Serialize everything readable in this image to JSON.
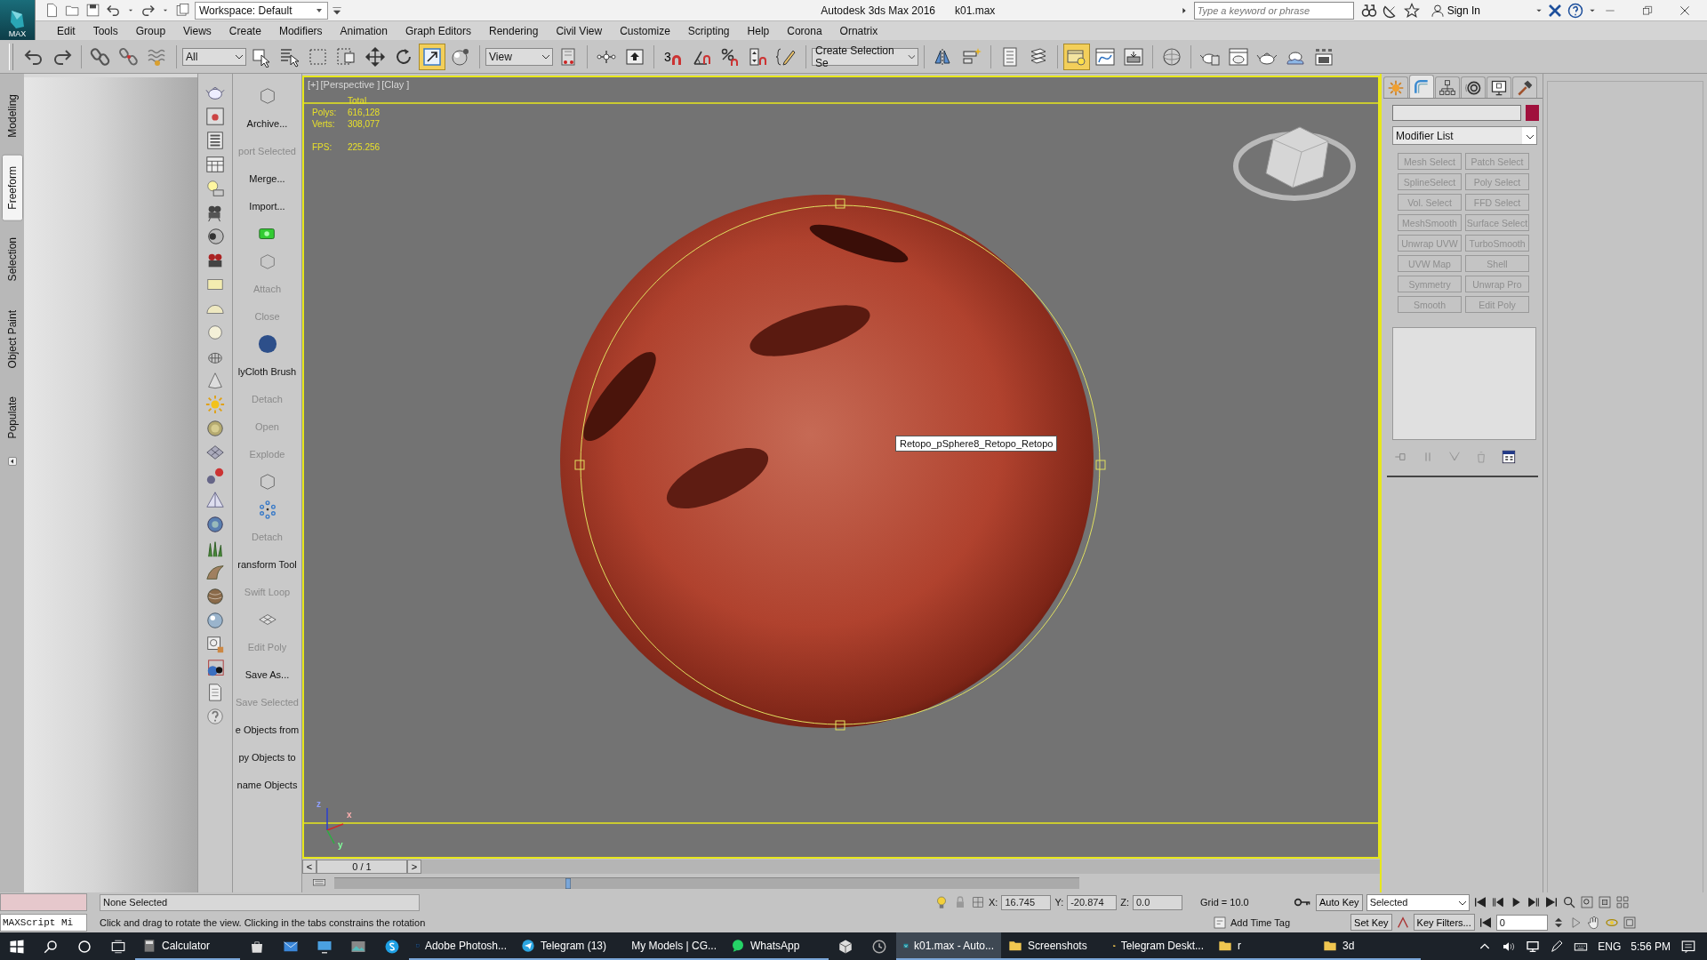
{
  "title_bar": {
    "logo": "MAX",
    "workspace": "Workspace: Default",
    "app_title": "Autodesk 3ds Max 2016",
    "file_name": "k01.max",
    "search": {
      "placeholder": "Type a keyword or phrase"
    },
    "sign_in": "Sign In"
  },
  "menu": [
    "Edit",
    "Tools",
    "Group",
    "Views",
    "Create",
    "Modifiers",
    "Animation",
    "Graph Editors",
    "Rendering",
    "Civil View",
    "Customize",
    "Scripting",
    "Help",
    "Corona",
    "Ornatrix"
  ],
  "toolbar": [
    {
      "kind": "button",
      "selected": false
    },
    {
      "kind": "button",
      "selected": false
    },
    {
      "kind": "button",
      "selected": false
    },
    {
      "kind": "button",
      "selected": false
    },
    {
      "kind": "button",
      "selected": false
    },
    {
      "kind": "dropdown",
      "value": "All"
    },
    {
      "kind": "button",
      "selected": false
    },
    {
      "kind": "button",
      "selected": false
    },
    {
      "kind": "button",
      "selected": false
    },
    {
      "kind": "button",
      "selected": false
    },
    {
      "kind": "button",
      "selected": false
    },
    {
      "kind": "button",
      "selected": false
    },
    {
      "kind": "button",
      "selected": true
    },
    {
      "kind": "button",
      "selected": false
    },
    {
      "kind": "dropdown",
      "value": "View"
    },
    {
      "kind": "button",
      "selected": false
    },
    {
      "kind": "button",
      "selected": false
    },
    {
      "kind": "button",
      "selected": false
    },
    {
      "kind": "snap",
      "label": "3",
      "selected": false
    },
    {
      "kind": "button",
      "selected": false
    },
    {
      "kind": "button",
      "selected": false
    },
    {
      "kind": "button",
      "selected": false
    },
    {
      "kind": "button",
      "selected": false
    },
    {
      "kind": "dropdown",
      "value": "Create Selection Se"
    },
    {
      "kind": "button",
      "selected": false
    },
    {
      "kind": "button",
      "selected": false
    },
    {
      "kind": "button",
      "selected": false
    },
    {
      "kind": "button",
      "selected": false
    },
    {
      "kind": "button",
      "selected": true
    },
    {
      "kind": "button",
      "selected": false
    },
    {
      "kind": "button",
      "selected": false
    },
    {
      "kind": "button",
      "selected": false
    },
    {
      "kind": "button",
      "selected": false
    },
    {
      "kind": "button",
      "selected": false
    },
    {
      "kind": "button",
      "selected": false
    },
    {
      "kind": "button",
      "selected": false
    },
    {
      "kind": "button",
      "selected": false
    }
  ],
  "ribbon_tabs": [
    {
      "label": "Modeling",
      "selected": false
    },
    {
      "label": "Freeform",
      "selected": true
    },
    {
      "label": "Selection",
      "selected": false
    },
    {
      "label": "Object Paint",
      "selected": false
    },
    {
      "label": "Populate",
      "selected": false
    }
  ],
  "custom_toolbar": [
    {
      "kind": "icon"
    },
    {
      "kind": "button",
      "label": "Archive...",
      "disabled": false
    },
    {
      "kind": "button",
      "label": "port Selected",
      "disabled": true
    },
    {
      "kind": "button",
      "label": "Merge...",
      "disabled": false
    },
    {
      "kind": "button",
      "label": "Import...",
      "disabled": false
    },
    {
      "kind": "icon"
    },
    {
      "kind": "icon"
    },
    {
      "kind": "button",
      "label": "Attach",
      "disabled": true
    },
    {
      "kind": "button",
      "label": "Close",
      "disabled": true
    },
    {
      "kind": "icon"
    },
    {
      "kind": "button",
      "label": "lyCloth Brush",
      "disabled": false
    },
    {
      "kind": "button",
      "label": "Detach",
      "disabled": true
    },
    {
      "kind": "button",
      "label": "Open",
      "disabled": true
    },
    {
      "kind": "button",
      "label": "Explode",
      "disabled": true
    },
    {
      "kind": "icon"
    },
    {
      "kind": "icon"
    },
    {
      "kind": "button",
      "label": "Detach",
      "disabled": true
    },
    {
      "kind": "button",
      "label": "ransform Tool",
      "disabled": false
    },
    {
      "kind": "button",
      "label": "Swift Loop",
      "disabled": true
    },
    {
      "kind": "icon"
    },
    {
      "kind": "button",
      "label": "Edit Poly",
      "disabled": true
    },
    {
      "kind": "button",
      "label": "Save As...",
      "disabled": false
    },
    {
      "kind": "button",
      "label": "Save Selected",
      "disabled": true
    },
    {
      "kind": "button",
      "label": "e Objects from",
      "disabled": false
    },
    {
      "kind": "button",
      "label": "py Objects to",
      "disabled": false
    },
    {
      "kind": "button",
      "label": "name Objects",
      "disabled": false
    }
  ],
  "viewport": {
    "labels": [
      "[+]",
      "[Perspective ]",
      "[Clay ]"
    ],
    "stats": {
      "heading": "Total",
      "rows": [
        {
          "label": "Polys:",
          "value": "616,128"
        },
        {
          "label": "Verts:",
          "value": "308,077"
        },
        {
          "label": "FPS:",
          "value": "225.256"
        }
      ]
    },
    "tooltip": "Retopo_pSphere8_Retopo_Retopo",
    "axes": [
      "z",
      "x",
      "y"
    ]
  },
  "time_slider": {
    "prev": "<",
    "position": "0 / 1",
    "level": 0,
    "next": ">"
  },
  "command_panel": {
    "tabs": [
      {
        "selected": false
      },
      {
        "selected": true
      },
      {
        "selected": false
      },
      {
        "selected": false
      },
      {
        "selected": false
      },
      {
        "selected": false
      }
    ],
    "modifier_list": "Modifier List",
    "modifier_buttons": [
      {
        "label": "Mesh Select",
        "disabled": true
      },
      {
        "label": "Patch Select",
        "disabled": true
      },
      {
        "label": "SplineSelect",
        "disabled": true
      },
      {
        "label": "Poly Select",
        "disabled": true
      },
      {
        "label": "Vol. Select",
        "disabled": true
      },
      {
        "label": "FFD Select",
        "disabled": true
      },
      {
        "label": "MeshSmooth",
        "disabled": true
      },
      {
        "label": "Surface Select",
        "disabled": true
      },
      {
        "label": "Unwrap UVW",
        "disabled": true
      },
      {
        "label": "TurboSmooth",
        "disabled": true
      },
      {
        "label": "UVW Map",
        "disabled": true
      },
      {
        "label": "Shell",
        "disabled": true
      },
      {
        "label": "Symmetry",
        "disabled": true
      },
      {
        "label": "Unwrap Pro",
        "disabled": true
      },
      {
        "label": "Smooth",
        "disabled": true
      },
      {
        "label": "Edit Poly",
        "disabled": true
      }
    ]
  },
  "status_bar": {
    "listener": "MAXScript Mi",
    "selection": "None Selected",
    "prompt": "Click and drag to rotate the view.  Clicking in the tabs constrains the rotation",
    "coords": [
      {
        "axis": "X:",
        "value": "16.745"
      },
      {
        "axis": "Y:",
        "value": "-20.874"
      },
      {
        "axis": "Z:",
        "value": "0.0"
      }
    ],
    "grid": "Grid = 10.0",
    "add_time_tag": "Add Time Tag",
    "auto_key": "Auto Key",
    "key_mode": "Selected",
    "set_key": "Set Key",
    "key_filters": "Key Filters...",
    "frame": "0"
  },
  "taskbar": {
    "items": [
      {
        "kind": "start"
      },
      {
        "kind": "search"
      },
      {
        "kind": "cortana"
      },
      {
        "kind": "task_view"
      },
      {
        "kind": "app",
        "label": "Calculator",
        "selected": false
      },
      {
        "kind": "pinned"
      },
      {
        "kind": "pinned"
      },
      {
        "kind": "pinned"
      },
      {
        "kind": "pinned"
      },
      {
        "kind": "pinned"
      },
      {
        "kind": "app",
        "label": "Adobe Photosh...",
        "selected": false
      },
      {
        "kind": "app",
        "label": "Telegram (13)",
        "selected": false
      },
      {
        "kind": "app",
        "label": "My Models | CG...",
        "selected": false
      },
      {
        "kind": "app",
        "label": "WhatsApp",
        "selected": false
      },
      {
        "kind": "pinned"
      },
      {
        "kind": "pinned"
      },
      {
        "kind": "app",
        "label": "k01.max - Auto...",
        "selected": true
      },
      {
        "kind": "app",
        "label": "Screenshots",
        "selected": false
      },
      {
        "kind": "app",
        "label": "Telegram Deskt...",
        "selected": false
      },
      {
        "kind": "app",
        "label": "r",
        "selected": false
      },
      {
        "kind": "app",
        "label": "3d",
        "selected": false
      }
    ],
    "language": "ENG",
    "clock": "5:56 PM"
  }
}
